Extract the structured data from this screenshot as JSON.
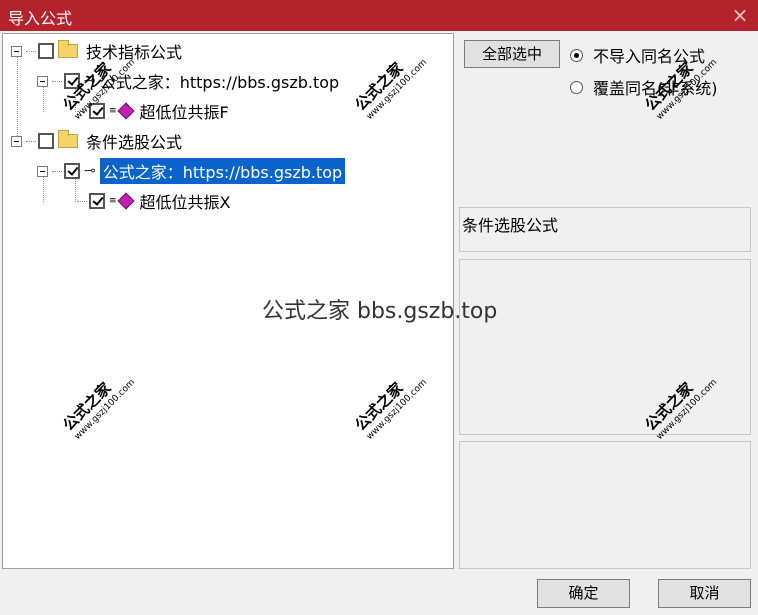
{
  "window": {
    "title": "导入公式",
    "close_icon": "×"
  },
  "tree": {
    "groups": [
      {
        "label": "技术指标公式",
        "source": {
          "label": "公式之家：https://bbs.gszb.top",
          "selected": false
        },
        "item": {
          "label": "超低位共振F"
        }
      },
      {
        "label": "条件选股公式",
        "source": {
          "label": "公式之家：https://bbs.gszb.top",
          "selected": true
        },
        "item": {
          "label": "超低位共振X"
        }
      }
    ]
  },
  "options": {
    "select_all_label": "全部选中",
    "radio1_label": "不导入同名公式",
    "radio2_label": "覆盖同名(非系统)",
    "selected_radio": 1
  },
  "info": {
    "type_label": "条件选股公式"
  },
  "buttons": {
    "ok": "确定",
    "cancel": "取消"
  },
  "watermark": {
    "center": "公式之家 bbs.gszb.top",
    "brand": "公式之家",
    "url": "www.gszj100.com"
  }
}
